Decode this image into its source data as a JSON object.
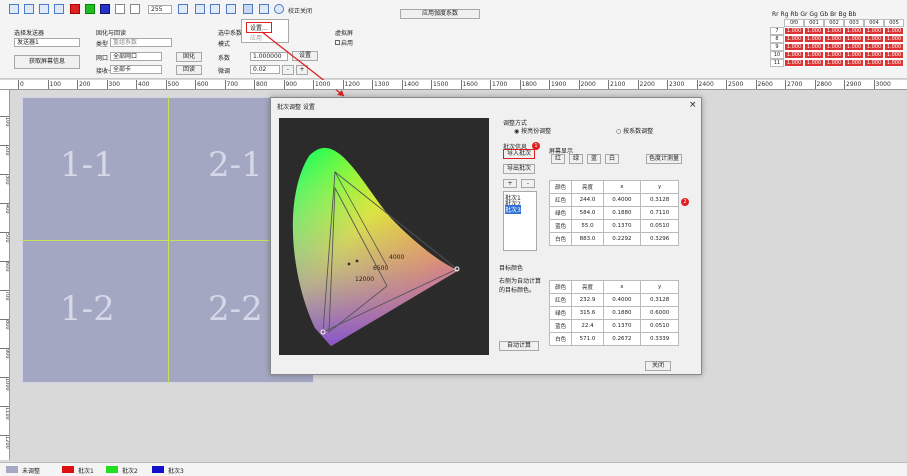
{
  "toolbar": {
    "num": "255",
    "correct": "校正关闭",
    "apply_all": "应用伽度系数",
    "menu_settings": "设置...",
    "menu_apply": "应用"
  },
  "ribbon": {
    "sender_group": "选择发送器",
    "sender_value": "发送器1",
    "partition_group": "固化与回读",
    "type_label": "类型",
    "type_value": "重组系数",
    "port_label": "网口",
    "port_value": "全部网口",
    "solidify": "固化",
    "card_label": "接收卡",
    "card_value": "全部卡",
    "readback": "回读",
    "read_button": "获取屏幕信息",
    "sel_coef": "选中系数",
    "mode_label": "模式",
    "coef_label": "系数",
    "coef_value": "1.000000",
    "set_button": "设置",
    "fine_label": "微调",
    "fine_value": "0.02",
    "minus": "-",
    "plus": "+",
    "virtual_group": "虚拟屏",
    "enable": "启用"
  },
  "ruler": [
    "0",
    "100",
    "200",
    "300",
    "400",
    "500",
    "600",
    "700",
    "800",
    "900",
    "1000",
    "1200",
    "1300",
    "1400",
    "1500",
    "1600",
    "1700",
    "1800",
    "1900",
    "2000",
    "2100",
    "2200",
    "2300",
    "2400",
    "2500",
    "2600",
    "2700",
    "2800",
    "2900",
    "3000"
  ],
  "vruler": [
    "100",
    "200",
    "300",
    "400",
    "500",
    "600",
    "700",
    "800",
    "900",
    "1000",
    "1100",
    "1200"
  ],
  "cells": [
    "1-1",
    "2-1",
    "1-2",
    "2-2"
  ],
  "mini_table": {
    "headers": [
      "Rr",
      "Rg",
      "Rb",
      "Gr",
      "Gg",
      "Gb",
      "Br",
      "Bg",
      "Bb"
    ],
    "cols": [
      "0f0",
      "001",
      "002",
      "003",
      "004",
      "005"
    ],
    "rows": [
      "7",
      "8",
      "9",
      "10",
      "11"
    ],
    "value": "1.000"
  },
  "dialog": {
    "title": "批次调整 设置",
    "close": "×",
    "adjust_mode": "调整方式",
    "mode_gain": "按亮份调整",
    "mode_coef": "按系数调整",
    "batch_info": "批次信息",
    "import": "导入批次",
    "export": "导出批次",
    "add": "+",
    "remove": "-",
    "batches": [
      "批次1",
      "批次2",
      "批次3"
    ],
    "screen_display": "屏幕显示",
    "red": "红",
    "green": "绿",
    "blue": "蓝",
    "white": "白",
    "gamut": "色度计测量",
    "measured": {
      "headers": [
        "颜色",
        "亮度",
        "x",
        "y"
      ],
      "rows": [
        [
          "红色",
          "244.0",
          "0.4000",
          "0.3128"
        ],
        [
          "绿色",
          "584.0",
          "0.1880",
          "0.7110"
        ],
        [
          "蓝色",
          "55.0",
          "0.1370",
          "0.0510"
        ],
        [
          "白色",
          "883.0",
          "0.2292",
          "0.3296"
        ]
      ]
    },
    "target_color": "目标颜色",
    "target_note": "右侧为自动计算的目标颜色。",
    "target": {
      "headers": [
        "颜色",
        "亮度",
        "x",
        "y"
      ],
      "rows": [
        [
          "红色",
          "232.9",
          "0.4000",
          "0.3128"
        ],
        [
          "绿色",
          "315.6",
          "0.1880",
          "0.6000"
        ],
        [
          "蓝色",
          "22.4",
          "0.1370",
          "0.0510"
        ],
        [
          "白色",
          "571.0",
          "0.2672",
          "0.3339"
        ]
      ]
    },
    "auto_calc": "自动计算",
    "close_button": "关闭",
    "cct": [
      "4000",
      "6500",
      "12000"
    ],
    "badges": [
      "1",
      "2"
    ]
  },
  "legend": [
    "未调整",
    "批次1",
    "批次2",
    "批次3"
  ],
  "colors": {
    "accent": "#e02020",
    "legend": [
      "#a7a9c4",
      "#dd1111",
      "#22dd22",
      "#1111cc"
    ]
  }
}
